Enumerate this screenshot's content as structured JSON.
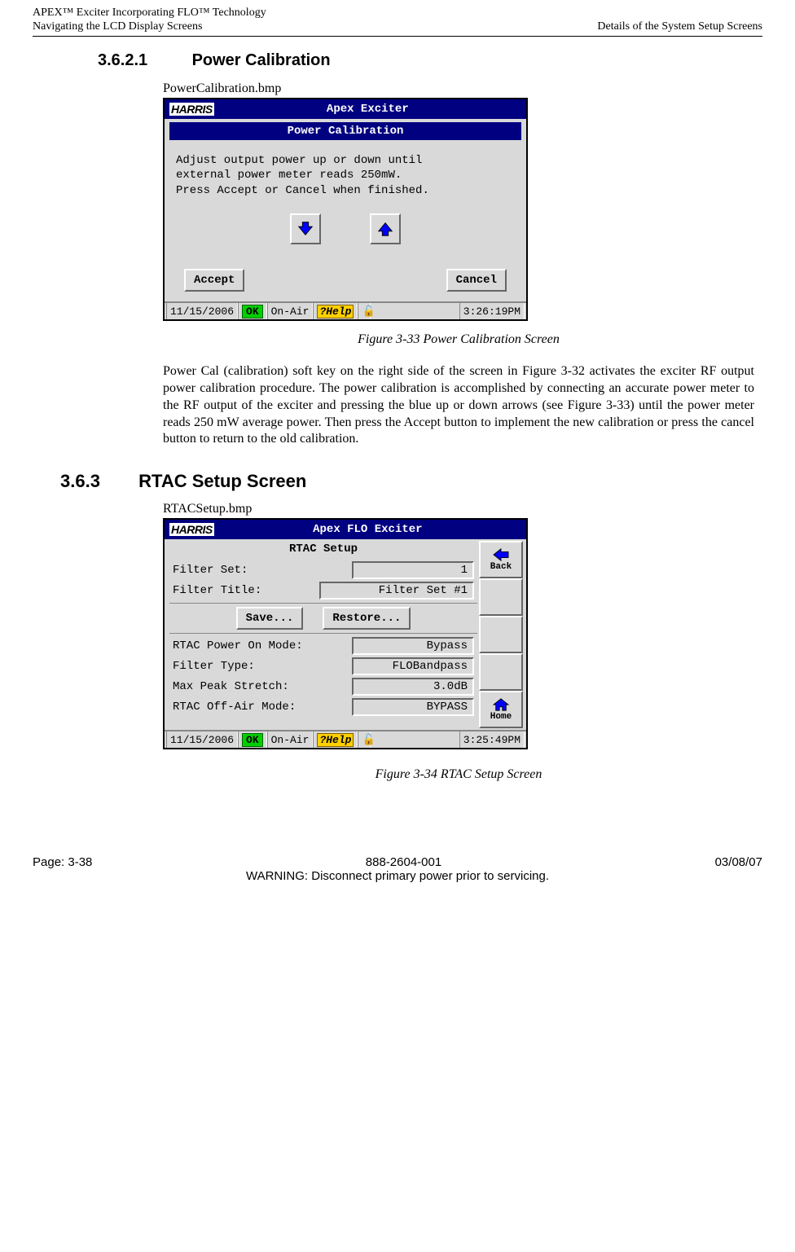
{
  "header": {
    "left": "APEX™ Exciter Incorporating FLO™ Technology\nNavigating the LCD Display Screens",
    "right": "\nDetails of the System Setup Screens"
  },
  "sections": {
    "power_cal": {
      "num": "3.6.2.1",
      "title": "Power Calibration"
    },
    "rtac": {
      "num": "3.6.3",
      "title": "RTAC Setup Screen"
    }
  },
  "pc": {
    "bmp": "PowerCalibration.bmp",
    "titlebar": "Apex Exciter",
    "subtitle": "Power Calibration",
    "instr1": "Adjust output power up or down until",
    "instr2": "external power meter reads 250mW.",
    "instr3": "Press Accept or Cancel when finished.",
    "accept": "Accept",
    "cancel": "Cancel",
    "status_date": "11/15/2006",
    "status_ok": "OK",
    "status_onair": "On-Air",
    "status_help": "?Help",
    "status_time": "3:26:19PM",
    "caption": "Figure 3-33  Power Calibration Screen",
    "para": "Power Cal (calibration) soft key on the right side of the screen in Figure 3-32 activates the exciter RF output power calibration procedure. The power calibration is accomplished by connecting an accurate power meter to the RF output of the exciter and pressing the blue up or down arrows (see Figure 3-33) until the power meter reads 250 mW average power. Then press the Accept button to implement the new calibration or press the cancel button to return to the old calibration."
  },
  "rtac": {
    "bmp": "RTACSetup.bmp",
    "titlebar": "Apex FLO Exciter",
    "heading": "RTAC Setup",
    "filter_set_label": "Filter Set:",
    "filter_set_value": "1",
    "filter_title_label": "Filter Title:",
    "filter_title_value": "Filter Set #1",
    "save": "Save...",
    "restore": "Restore...",
    "power_on_label": "RTAC Power On Mode:",
    "power_on_value": "Bypass",
    "filter_type_label": "Filter Type:",
    "filter_type_value": "FLOBandpass",
    "max_peak_label": "Max Peak Stretch:",
    "max_peak_value": "3.0dB",
    "offair_label": "RTAC Off-Air Mode:",
    "offair_value": "BYPASS",
    "back": "Back",
    "home": "Home",
    "status_date": "11/15/2006",
    "status_ok": "OK",
    "status_onair": "On-Air",
    "status_help": "?Help",
    "status_time": "3:25:49PM",
    "caption": "Figure 3-34  RTAC Setup Screen"
  },
  "footer": {
    "page": "Page: 3-38",
    "docno": "888-2604-001",
    "date": "03/08/07",
    "warning": "WARNING: Disconnect primary power prior to servicing."
  }
}
